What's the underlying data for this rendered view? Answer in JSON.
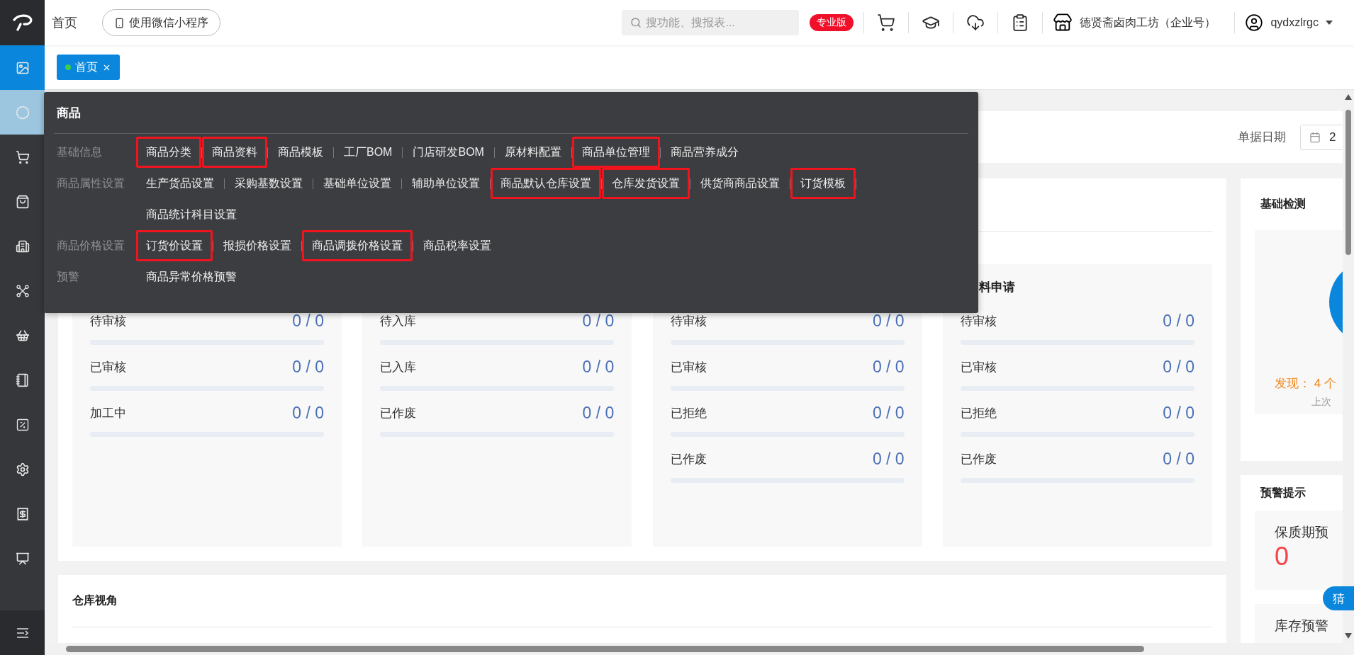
{
  "topbar": {
    "page_title": "首页",
    "mini_program_button": "使用微信小程序",
    "search": {
      "placeholder": "搜功能、搜报表..."
    },
    "edition_badge": "专业版",
    "company": "德贤斋卤肉工坊（企业号）",
    "username": "qydxzlrgc"
  },
  "sidebar": {
    "items": [
      {
        "selected": true,
        "expanded": false
      },
      {
        "selected": false,
        "expanded": true
      },
      {
        "selected": false,
        "expanded": false
      },
      {
        "selected": false,
        "expanded": false
      },
      {
        "selected": false,
        "expanded": false
      },
      {
        "selected": false,
        "expanded": false
      },
      {
        "selected": false,
        "expanded": false
      },
      {
        "selected": false,
        "expanded": false
      },
      {
        "selected": false,
        "expanded": false
      },
      {
        "selected": false,
        "expanded": false
      },
      {
        "selected": false,
        "expanded": false
      },
      {
        "selected": false,
        "expanded": false
      }
    ]
  },
  "tabs": [
    {
      "label": "首页",
      "selected": true
    }
  ],
  "menu": {
    "title": "商品",
    "groups": [
      {
        "label": "基础信息",
        "items": [
          {
            "label": "商品分类",
            "highlighted": true
          },
          {
            "label": "商品资料",
            "highlighted": true
          },
          {
            "label": "商品模板",
            "highlighted": false
          },
          {
            "label": "工厂BOM",
            "highlighted": false
          },
          {
            "label": "门店研发BOM",
            "highlighted": false
          },
          {
            "label": "原材料配置",
            "highlighted": false
          },
          {
            "label": "商品单位管理",
            "highlighted": true
          },
          {
            "label": "商品营养成分",
            "highlighted": false
          }
        ]
      },
      {
        "label": "商品属性设置",
        "items": [
          {
            "label": "生产货品设置",
            "highlighted": false
          },
          {
            "label": "采购基数设置",
            "highlighted": false
          },
          {
            "label": "基础单位设置",
            "highlighted": false
          },
          {
            "label": "辅助单位设置",
            "highlighted": false
          },
          {
            "label": "商品默认仓库设置",
            "highlighted": true
          },
          {
            "label": "仓库发货设置",
            "highlighted": true
          },
          {
            "label": "供货商商品设置",
            "highlighted": false
          },
          {
            "label": "订货模板",
            "highlighted": true
          },
          {
            "label": "商品统计科目设置",
            "highlighted": false
          }
        ]
      },
      {
        "label": "商品价格设置",
        "items": [
          {
            "label": "订货价设置",
            "highlighted": true
          },
          {
            "label": "报损价格设置",
            "highlighted": false
          },
          {
            "label": "商品调拨价格设置",
            "highlighted": true
          },
          {
            "label": "商品税率设置",
            "highlighted": false
          }
        ]
      },
      {
        "label": "预警",
        "items": [
          {
            "label": "商品异常价格预警",
            "highlighted": false
          }
        ]
      }
    ]
  },
  "filter": {
    "label": "单据日期",
    "date_value": "2"
  },
  "panels": [
    {
      "rows": [
        {
          "label": "待审核",
          "value": "0 / 0",
          "level": 0
        },
        {
          "label": "已审核",
          "value": "0 / 0",
          "level": 0
        },
        {
          "label": "加工中",
          "value": "0 / 0",
          "level": 0
        }
      ]
    },
    {
      "rows": [
        {
          "label": "待入库",
          "value": "0 / 0",
          "level": 0
        },
        {
          "label": "已入库",
          "value": "0 / 0",
          "level": 0
        },
        {
          "label": "已作废",
          "value": "0 / 0",
          "level": 0
        }
      ]
    },
    {
      "rows": [
        {
          "label": "待审核",
          "value": "0 / 0",
          "level": 0
        },
        {
          "label": "已审核",
          "value": "0 / 0",
          "level": 0
        },
        {
          "label": "已拒绝",
          "value": "0 / 0",
          "level": 0
        },
        {
          "label": "已作废",
          "value": "0 / 0",
          "level": 0
        }
      ]
    },
    {
      "title": "料申请",
      "rows": [
        {
          "label": "待审核",
          "value": "0 / 0",
          "level": 0
        },
        {
          "label": "已审核",
          "value": "0 / 0",
          "level": 0
        },
        {
          "label": "已拒绝",
          "value": "0 / 0",
          "level": 0
        },
        {
          "label": "已作废",
          "value": "0 / 0",
          "level": 0
        }
      ]
    }
  ],
  "basic_check": {
    "title": "基础检测",
    "found": "发现： 4 个",
    "last_check": "上次"
  },
  "warnings": {
    "title": "预警提示",
    "items": [
      {
        "label": "保质期预",
        "count": "0"
      },
      {
        "label": "库存预警"
      }
    ]
  },
  "warehouse": {
    "title": "仓库视角"
  },
  "assistant_badge": "猜"
}
